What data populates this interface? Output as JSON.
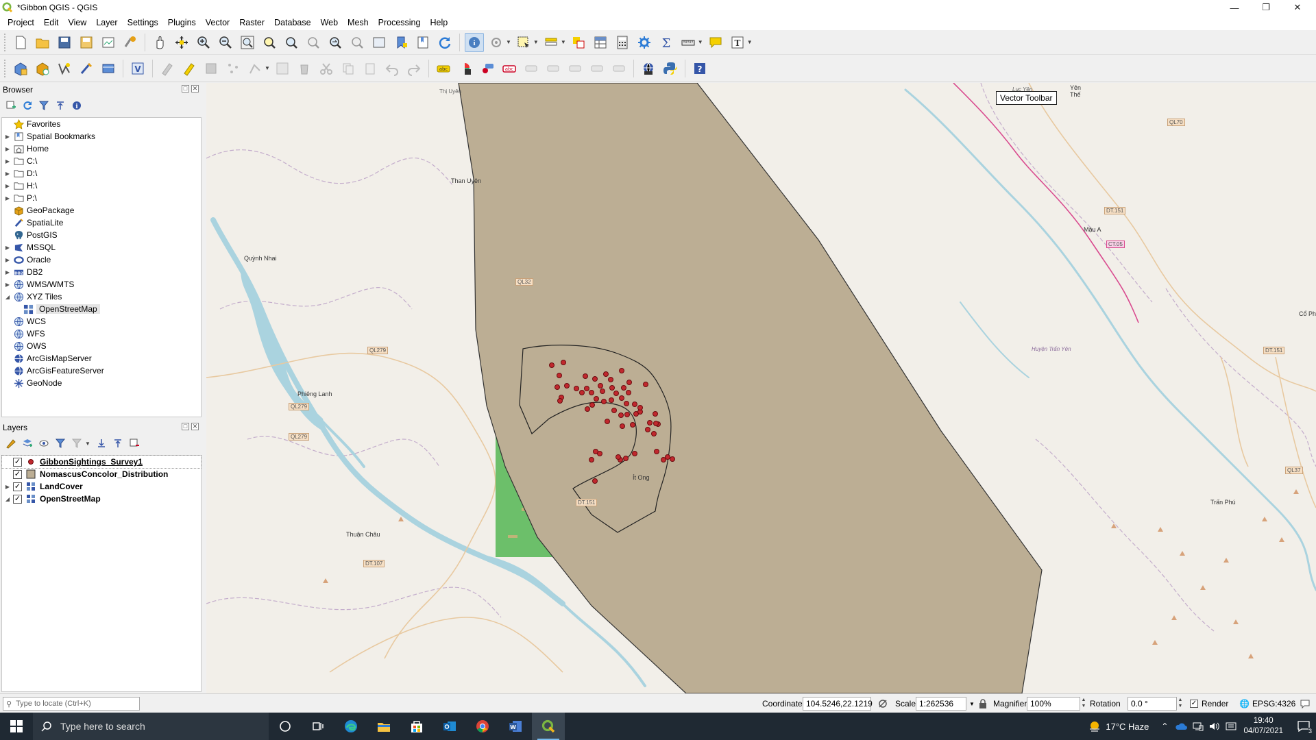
{
  "window": {
    "title": "*Gibbon QGIS - QGIS"
  },
  "menu": [
    "Project",
    "Edit",
    "View",
    "Layer",
    "Settings",
    "Plugins",
    "Vector",
    "Raster",
    "Database",
    "Web",
    "Mesh",
    "Processing",
    "Help"
  ],
  "browser": {
    "title": "Browser",
    "items": [
      {
        "label": "Favorites",
        "icon": "star-icon",
        "expandable": false
      },
      {
        "label": "Spatial Bookmarks",
        "icon": "bookmark-icon",
        "expandable": true
      },
      {
        "label": "Home",
        "icon": "home-folder-icon",
        "expandable": true
      },
      {
        "label": "C:\\",
        "icon": "folder-icon",
        "expandable": true
      },
      {
        "label": "D:\\",
        "icon": "folder-icon",
        "expandable": true
      },
      {
        "label": "H:\\",
        "icon": "folder-icon",
        "expandable": true
      },
      {
        "label": "P:\\",
        "icon": "folder-icon",
        "expandable": true
      },
      {
        "label": "GeoPackage",
        "icon": "geopackage-icon",
        "expandable": false
      },
      {
        "label": "SpatiaLite",
        "icon": "spatialite-icon",
        "expandable": false
      },
      {
        "label": "PostGIS",
        "icon": "postgis-icon",
        "expandable": false
      },
      {
        "label": "MSSQL",
        "icon": "mssql-icon",
        "expandable": true
      },
      {
        "label": "Oracle",
        "icon": "oracle-icon",
        "expandable": true
      },
      {
        "label": "DB2",
        "icon": "db2-icon",
        "expandable": true
      },
      {
        "label": "WMS/WMTS",
        "icon": "globe-icon",
        "expandable": true
      },
      {
        "label": "XYZ Tiles",
        "icon": "globe-icon",
        "expandable": true,
        "expanded": true
      },
      {
        "label": "OpenStreetMap",
        "icon": "xyz-tile-icon",
        "expandable": false,
        "child": true
      },
      {
        "label": "WCS",
        "icon": "globe-icon",
        "expandable": false
      },
      {
        "label": "WFS",
        "icon": "globe-icon",
        "expandable": false
      },
      {
        "label": "OWS",
        "icon": "globe-icon",
        "expandable": false
      },
      {
        "label": "ArcGisMapServer",
        "icon": "arcgis-icon",
        "expandable": false
      },
      {
        "label": "ArcGisFeatureServer",
        "icon": "arcgis-icon",
        "expandable": false
      },
      {
        "label": "GeoNode",
        "icon": "geonode-icon",
        "expandable": false
      }
    ]
  },
  "layers": {
    "title": "Layers",
    "items": [
      {
        "label": "GibbonSightings_Survey1",
        "checked": true,
        "type": "point",
        "expandable": false,
        "selected": true
      },
      {
        "label": "NomascusConcolor_Distribution",
        "checked": true,
        "type": "polygon",
        "expandable": false
      },
      {
        "label": "LandCover",
        "checked": true,
        "type": "raster",
        "expandable": true
      },
      {
        "label": "OpenStreetMap",
        "checked": true,
        "type": "raster",
        "expandable": true,
        "expanded": true
      }
    ]
  },
  "map": {
    "tooltip": "Vector Toolbar",
    "place_labels": [
      "Yên Thế",
      "Than Uyên",
      "Quỳnh Nhai",
      "Phiêng Lanh",
      "Thuận Châu",
      "Ít Ong",
      "Mậu A",
      "Trấn Phú",
      "Cổ Phúc",
      "Lục Yên",
      "Huyện Trấn Yên",
      "Thị Uyên"
    ],
    "road_labels": [
      "QL70",
      "DT.151",
      "CT.05",
      "DT.151",
      "QL37",
      "QL279",
      "QL279",
      "QL279",
      "DT.107",
      "QL32",
      "DT.151"
    ],
    "colors": {
      "polygon_fill": "#bcae94",
      "points": "#c0282d",
      "landcover": "#6cbf6a",
      "water": "#aad3df"
    }
  },
  "status": {
    "locate_placeholder": "Type to locate (Ctrl+K)",
    "coordinate_label": "Coordinate",
    "coordinate_value": "104.5246,22.1219",
    "scale_label": "Scale",
    "scale_value": "1:262536",
    "magnifier_label": "Magnifier",
    "magnifier_value": "100%",
    "rotation_label": "Rotation",
    "rotation_value": "0.0 °",
    "render_label": "Render",
    "crs": "EPSG:4326"
  },
  "taskbar": {
    "search_placeholder": "Type here to search",
    "weather": "17°C  Haze",
    "time": "19:40",
    "date": "04/07/2021",
    "notifications": "3"
  }
}
